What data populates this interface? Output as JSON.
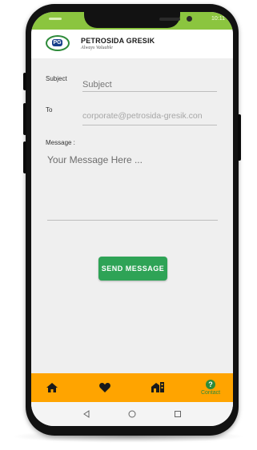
{
  "status": {
    "time": "10:11"
  },
  "header": {
    "brand": "PETROSIDA GRESIK",
    "tagline": "Always Valuable",
    "logo_mark": "PG"
  },
  "form": {
    "subject_label": "Subject",
    "subject_placeholder": "Subject",
    "to_label": "To",
    "to_value": "corporate@petrosida-gresik.con",
    "message_label": "Message :",
    "message_placeholder": "Your Message Here ...",
    "send_label": "SEND MESSAGE"
  },
  "bottom_nav": {
    "items": [
      {
        "icon": "home-icon",
        "label": ""
      },
      {
        "icon": "heart-icon",
        "label": ""
      },
      {
        "icon": "building-icon",
        "label": ""
      },
      {
        "icon": "help-icon",
        "label": "Contact"
      }
    ],
    "active_color": "#2e8b3a",
    "bar_color": "#ffa400"
  },
  "colors": {
    "accent": "#2ea356",
    "statusbar": "#8bc53f"
  }
}
